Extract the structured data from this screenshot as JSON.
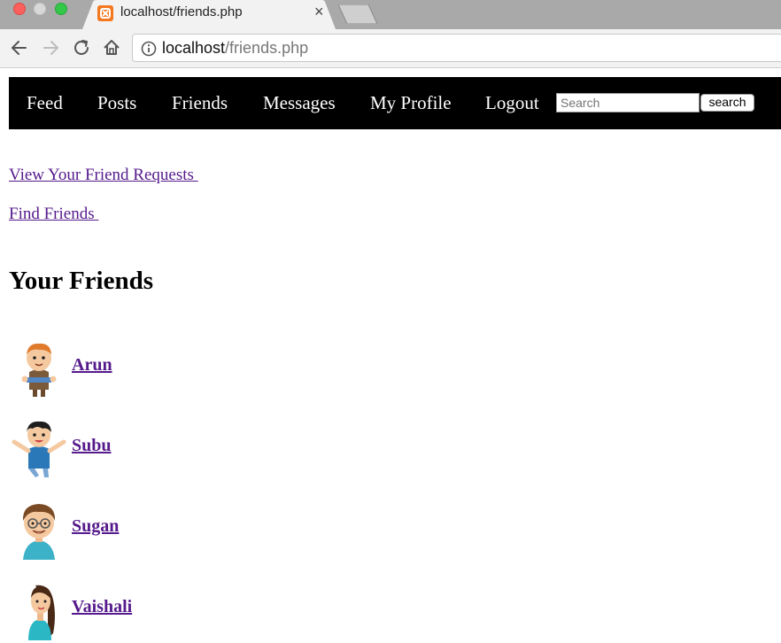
{
  "browser": {
    "tab_title": "localhost/friends.php",
    "tab_close": "×",
    "url_host": "localhost",
    "url_path": "/friends.php"
  },
  "nav": {
    "items": [
      "Feed",
      "Posts",
      "Friends",
      "Messages",
      "My Profile",
      "Logout"
    ],
    "search_placeholder": "Search",
    "search_button": "search"
  },
  "links": {
    "friend_requests": "View Your Friend Requests ",
    "find_friends": "Find Friends "
  },
  "heading": "Your Friends",
  "friends": [
    {
      "name": "Arun",
      "avatar": "boy-orange-hair-avatar"
    },
    {
      "name": "Subu",
      "avatar": "boy-blue-shirt-avatar"
    },
    {
      "name": "Sugan",
      "avatar": "boy-glasses-avatar"
    },
    {
      "name": "Vaishali",
      "avatar": "girl-long-hair-avatar"
    }
  ],
  "colors": {
    "navbar": "#000000",
    "visited_link": "#551a8b",
    "tabstrip": "#a9a9a9"
  }
}
